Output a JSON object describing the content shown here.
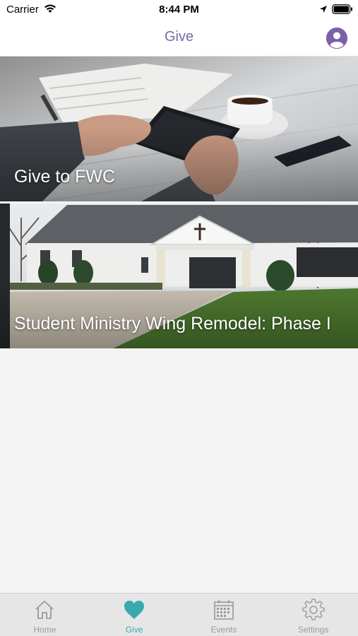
{
  "status_bar": {
    "carrier": "Carrier",
    "time": "8:44 PM",
    "icons": [
      "wifi-icon",
      "location-icon",
      "battery-icon"
    ]
  },
  "nav": {
    "title": "Give",
    "profile_icon": "person-circle-icon"
  },
  "cards": [
    {
      "title": "Give to FWC",
      "image": "tablet-on-table-photo"
    },
    {
      "title": "Student Ministry Wing Remodel: Phase I",
      "image": "church-building-photo"
    }
  ],
  "tabs": [
    {
      "label": "Home",
      "icon": "home-icon",
      "active": false
    },
    {
      "label": "Give",
      "icon": "heart-icon",
      "active": true
    },
    {
      "label": "Events",
      "icon": "calendar-icon",
      "active": false
    },
    {
      "label": "Settings",
      "icon": "gear-icon",
      "active": false
    }
  ],
  "colors": {
    "accent_purple": "#7b6aa6",
    "active_tab": "#3aa9ad",
    "inactive_tab": "#9a9a9a",
    "tab_bar_bg": "#e6e6e6",
    "page_bg": "#f4f4f4"
  }
}
